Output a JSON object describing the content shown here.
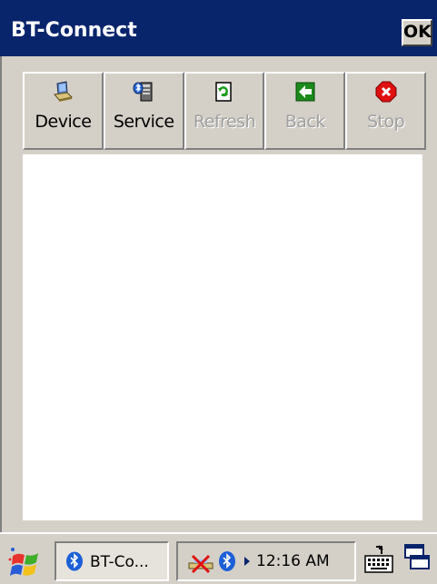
{
  "window": {
    "title": "BT-Connect",
    "ok_label": "OK"
  },
  "toolbar": {
    "buttons": [
      {
        "label": "Device",
        "icon": "device-icon",
        "enabled": true
      },
      {
        "label": "Service",
        "icon": "service-icon",
        "enabled": true
      },
      {
        "label": "Refresh",
        "icon": "refresh-icon",
        "enabled": false
      },
      {
        "label": "Back",
        "icon": "back-icon",
        "enabled": false
      },
      {
        "label": "Stop",
        "icon": "stop-icon",
        "enabled": false
      }
    ]
  },
  "taskbar": {
    "task_label": "BT-Co...",
    "clock": "12:16 AM"
  },
  "colors": {
    "titlebar": "#08246b",
    "face": "#d4d0c8",
    "bluetooth": "#1c5fd6",
    "stop_red": "#e01010",
    "back_green": "#1a8a1a"
  }
}
